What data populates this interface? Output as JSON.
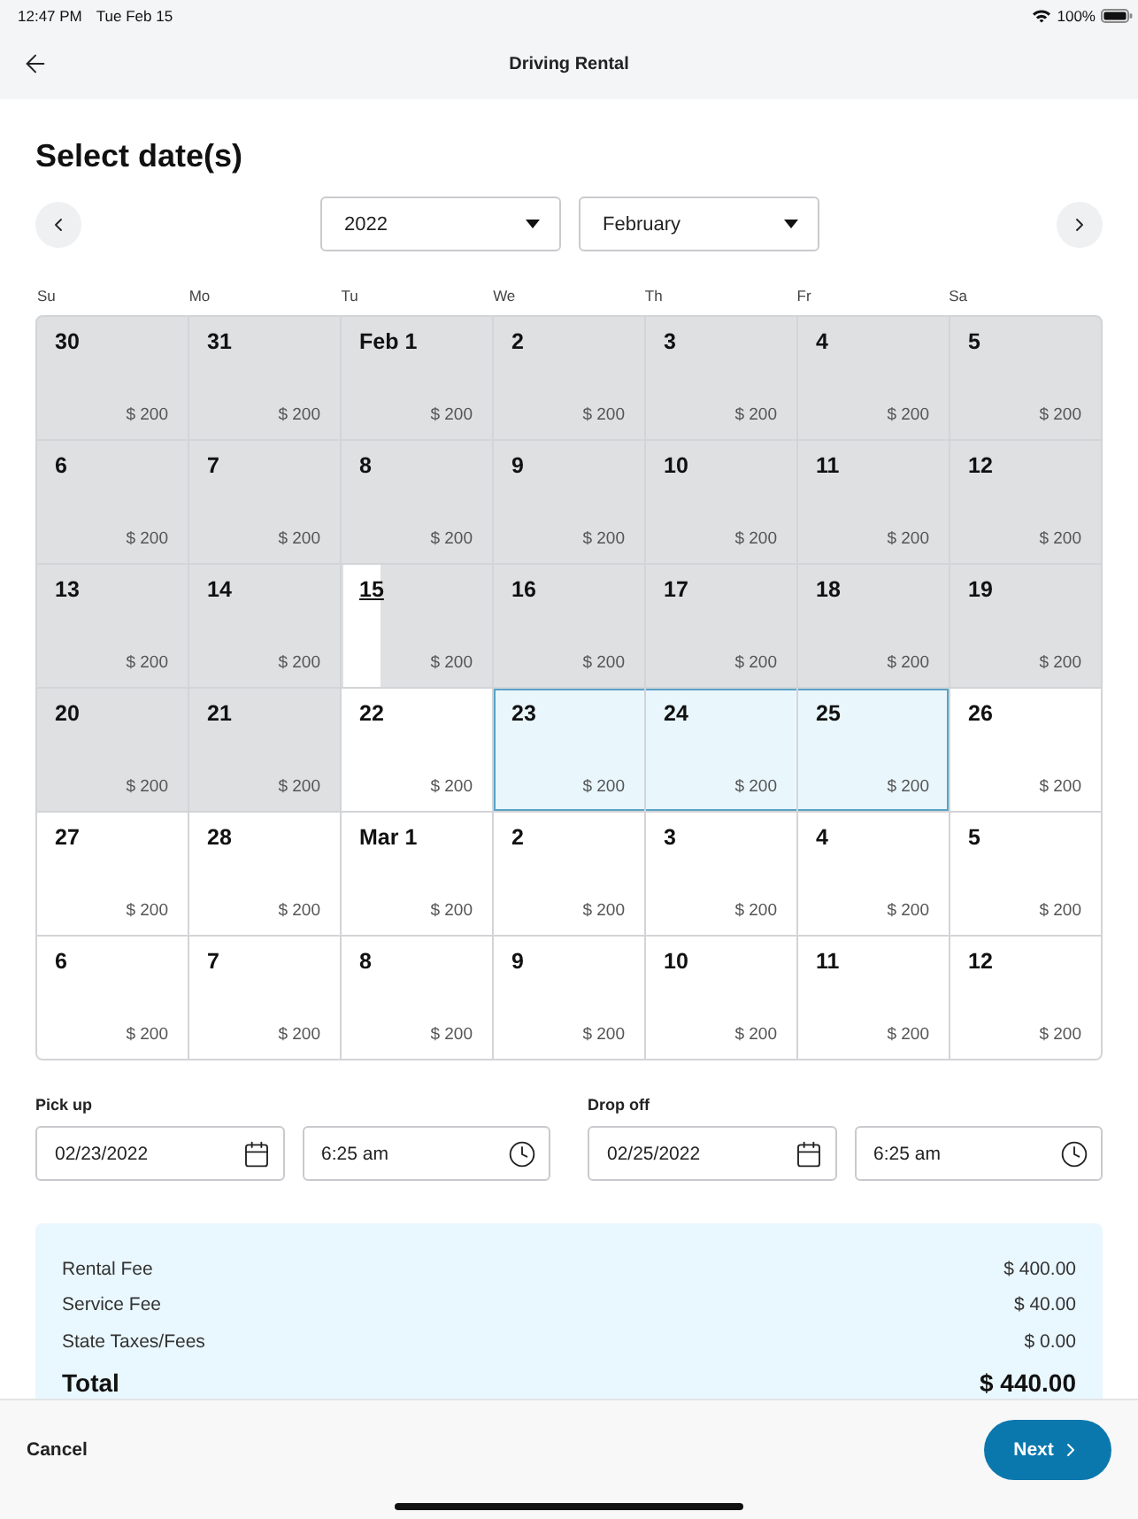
{
  "status_bar": {
    "time": "12:47 PM",
    "date": "Tue Feb 15",
    "battery": "100%"
  },
  "nav_bar": {
    "title": "Driving Rental"
  },
  "page_title": "Select date(s)",
  "date_controls": {
    "year": "2022",
    "month": "February"
  },
  "calendar": {
    "weekdays": [
      "Su",
      "Mo",
      "Tu",
      "We",
      "Th",
      "Fr",
      "Sa"
    ],
    "days": [
      {
        "label": "30",
        "price": "$ 200",
        "kind": "unavailable",
        "selected": false
      },
      {
        "label": "31",
        "price": "$ 200",
        "kind": "unavailable",
        "selected": false
      },
      {
        "label": "Feb 1",
        "price": "$ 200",
        "kind": "unavailable",
        "selected": false
      },
      {
        "label": "2",
        "price": "$ 200",
        "kind": "unavailable",
        "selected": false
      },
      {
        "label": "3",
        "price": "$ 200",
        "kind": "unavailable",
        "selected": false
      },
      {
        "label": "4",
        "price": "$ 200",
        "kind": "unavailable",
        "selected": false
      },
      {
        "label": "5",
        "price": "$ 200",
        "kind": "unavailable",
        "selected": false
      },
      {
        "label": "6",
        "price": "$ 200",
        "kind": "unavailable",
        "selected": false
      },
      {
        "label": "7",
        "price": "$ 200",
        "kind": "unavailable",
        "selected": false
      },
      {
        "label": "8",
        "price": "$ 200",
        "kind": "unavailable",
        "selected": false
      },
      {
        "label": "9",
        "price": "$ 200",
        "kind": "unavailable",
        "selected": false
      },
      {
        "label": "10",
        "price": "$ 200",
        "kind": "unavailable",
        "selected": false
      },
      {
        "label": "11",
        "price": "$ 200",
        "kind": "unavailable",
        "selected": false
      },
      {
        "label": "12",
        "price": "$ 200",
        "kind": "unavailable",
        "selected": false
      },
      {
        "label": "13",
        "price": "$ 200",
        "kind": "unavailable",
        "selected": false
      },
      {
        "label": "14",
        "price": "$ 200",
        "kind": "unavailable",
        "selected": false
      },
      {
        "label": "15",
        "price": "$ 200",
        "kind": "today",
        "selected": false
      },
      {
        "label": "16",
        "price": "$ 200",
        "kind": "unavailable",
        "selected": false
      },
      {
        "label": "17",
        "price": "$ 200",
        "kind": "unavailable",
        "selected": false
      },
      {
        "label": "18",
        "price": "$ 200",
        "kind": "unavailable",
        "selected": false
      },
      {
        "label": "19",
        "price": "$ 200",
        "kind": "unavailable",
        "selected": false
      },
      {
        "label": "20",
        "price": "$ 200",
        "kind": "unavailable",
        "selected": false
      },
      {
        "label": "21",
        "price": "$ 200",
        "kind": "unavailable",
        "selected": false
      },
      {
        "label": "22",
        "price": "$ 200",
        "kind": "available",
        "selected": false
      },
      {
        "label": "23",
        "price": "$ 200",
        "kind": "available",
        "selected": true
      },
      {
        "label": "24",
        "price": "$ 200",
        "kind": "available",
        "selected": true
      },
      {
        "label": "25",
        "price": "$ 200",
        "kind": "available",
        "selected": true
      },
      {
        "label": "26",
        "price": "$ 200",
        "kind": "available",
        "selected": false
      },
      {
        "label": "27",
        "price": "$ 200",
        "kind": "available",
        "selected": false
      },
      {
        "label": "28",
        "price": "$ 200",
        "kind": "available",
        "selected": false
      },
      {
        "label": "Mar 1",
        "price": "$ 200",
        "kind": "available",
        "selected": false
      },
      {
        "label": "2",
        "price": "$ 200",
        "kind": "available",
        "selected": false
      },
      {
        "label": "3",
        "price": "$ 200",
        "kind": "available",
        "selected": false
      },
      {
        "label": "4",
        "price": "$ 200",
        "kind": "available",
        "selected": false
      },
      {
        "label": "5",
        "price": "$ 200",
        "kind": "available",
        "selected": false
      },
      {
        "label": "6",
        "price": "$ 200",
        "kind": "available",
        "selected": false
      },
      {
        "label": "7",
        "price": "$ 200",
        "kind": "available",
        "selected": false
      },
      {
        "label": "8",
        "price": "$ 200",
        "kind": "available",
        "selected": false
      },
      {
        "label": "9",
        "price": "$ 200",
        "kind": "available",
        "selected": false
      },
      {
        "label": "10",
        "price": "$ 200",
        "kind": "available",
        "selected": false
      },
      {
        "label": "11",
        "price": "$ 200",
        "kind": "available",
        "selected": false
      },
      {
        "label": "12",
        "price": "$ 200",
        "kind": "available",
        "selected": false
      }
    ]
  },
  "trip": [
    {
      "label": "Pick up",
      "date": "02/23/2022",
      "time": "6:25 am"
    },
    {
      "label": "Drop off",
      "date": "02/25/2022",
      "time": "6:25 am"
    }
  ],
  "fees": [
    {
      "label": "Rental Fee",
      "amount": "$ 400.00"
    },
    {
      "label": "Service Fee",
      "amount": "$ 40.00"
    },
    {
      "label": "State Taxes/Fees",
      "amount": "$ 0.00"
    }
  ],
  "total": {
    "label": "Total",
    "amount": "$ 440.00"
  },
  "footer": {
    "cancel": "Cancel",
    "next": "Next"
  }
}
